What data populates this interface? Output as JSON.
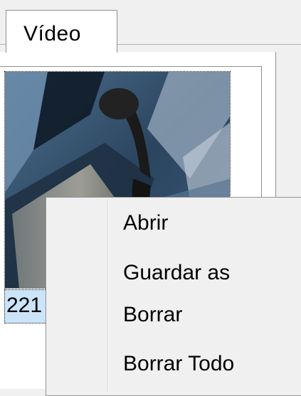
{
  "tabs": [
    {
      "label": "Vídeo",
      "active": true
    }
  ],
  "thumbnail": {
    "caption": "221"
  },
  "context_menu": {
    "items": [
      {
        "label": "Abrir"
      },
      {
        "label": "Guardar as"
      },
      {
        "label": "Borrar"
      },
      {
        "label": "Borrar Todo"
      }
    ]
  },
  "colors": {
    "selection": "#cce4f7",
    "menu_background": "#f0f0f0",
    "border": "#8f8f8f"
  }
}
